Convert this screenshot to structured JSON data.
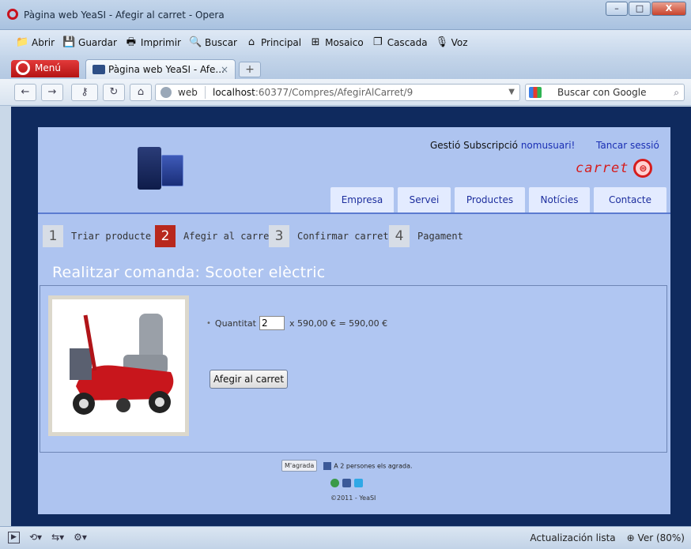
{
  "window": {
    "title": "Pàgina web YeaSI - Afegir al carret - Opera",
    "buttons": {
      "minimize": "–",
      "maximize": "□",
      "close": "X"
    }
  },
  "menubar": {
    "items": [
      {
        "label": "Abrir",
        "icon": "folder-icon"
      },
      {
        "label": "Guardar",
        "icon": "save-icon"
      },
      {
        "label": "Imprimir",
        "icon": "printer-icon"
      },
      {
        "label": "Buscar",
        "icon": "search-icon"
      },
      {
        "label": "Principal",
        "icon": "home-icon"
      },
      {
        "label": "Mosaico",
        "icon": "tile-icon"
      },
      {
        "label": "Cascada",
        "icon": "cascade-icon"
      },
      {
        "label": "Voz",
        "icon": "microphone-icon"
      }
    ]
  },
  "tabs": {
    "menu_label": "Menú",
    "active_tab": "Pàgina web YeaSI - Afe...",
    "close": "×",
    "new_tab": "+"
  },
  "navbar": {
    "web_label": "web",
    "url_host": "localhost",
    "url_path": ":60377/Compres/AfegirAlCarret/9",
    "search_placeholder": "Buscar con Google"
  },
  "site": {
    "top_text": "Gestió Subscripció",
    "user_link": "nomusuari!",
    "logout": "Tancar sessió",
    "cart_label": "carret",
    "nav": [
      "Empresa",
      "Servei",
      "Productes",
      "Notícies",
      "Contacte"
    ],
    "steps": [
      {
        "num": "1",
        "label": "Triar producte"
      },
      {
        "num": "2",
        "label": "Afegir al carret"
      },
      {
        "num": "3",
        "label": "Confirmar carret"
      },
      {
        "num": "4",
        "label": "Pagament"
      }
    ],
    "heading": "Realitzar comanda: Scooter elèctric",
    "quantity_label": "Quantitat",
    "quantity_value": "2",
    "price_text": "x 590,00 € = 590,00 €",
    "add_button": "Afegir al carret",
    "like_button": "M'agrada",
    "like_text": "A 2 persones els agrada.",
    "copyright": "©2011 - YeaSI"
  },
  "statusbar": {
    "update": "Actualización lista",
    "zoom": "Ver (80%)"
  }
}
